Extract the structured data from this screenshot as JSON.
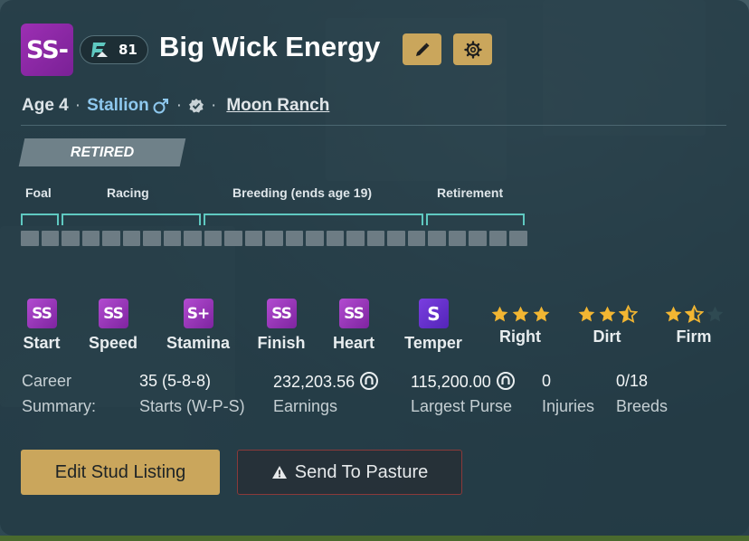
{
  "horse": {
    "grade": "SS-",
    "rating": "81",
    "name": "Big Wick Energy",
    "age": "Age 4",
    "sex": "Stallion",
    "ranch": "Moon Ranch",
    "status": "RETIRED"
  },
  "lifecycle": {
    "phases": [
      {
        "label": "Foal"
      },
      {
        "label": "Racing"
      },
      {
        "label": "Breeding (ends age 19)"
      },
      {
        "label": "Retirement"
      }
    ],
    "total_years": 25
  },
  "stats": [
    {
      "grade": "SS",
      "label": "Start"
    },
    {
      "grade": "SS",
      "label": "Speed"
    },
    {
      "grade": "S+",
      "label": "Stamina"
    },
    {
      "grade": "SS",
      "label": "Finish"
    },
    {
      "grade": "SS",
      "label": "Heart"
    },
    {
      "grade": "S",
      "label": "Temper"
    }
  ],
  "surfaces": [
    {
      "label": "Right",
      "stars": 3
    },
    {
      "label": "Dirt",
      "stars": 2.5
    },
    {
      "label": "Firm",
      "stars": 1.5
    }
  ],
  "summary": {
    "career_label_1": "Career",
    "career_label_2": "Summary:",
    "starts_value": "35 (5-8-8)",
    "starts_label": "Starts (W-P-S)",
    "earnings_value": "232,203.56",
    "earnings_label": "Earnings",
    "largest_purse_value": "115,200.00",
    "largest_purse_label": "Largest Purse",
    "injuries_value": "0",
    "injuries_label": "Injuries",
    "breeds_value": "0/18",
    "breeds_label": "Breeds"
  },
  "actions": {
    "edit_label": "Edit Stud Listing",
    "pasture_label": "Send To Pasture"
  },
  "colors": {
    "gold": "#caa65c",
    "grade_purple": "#9c2fb3",
    "accent_teal": "#5fc9c1",
    "link_blue": "#8ec8ee",
    "star_gold": "#f2b632"
  },
  "icons": {
    "edit": "pencil-icon",
    "settings": "gear-icon",
    "male": "male-symbol-icon",
    "verified": "verified-check-icon",
    "currency": "horseshoe-coin-icon",
    "warning": "warning-triangle-icon"
  }
}
